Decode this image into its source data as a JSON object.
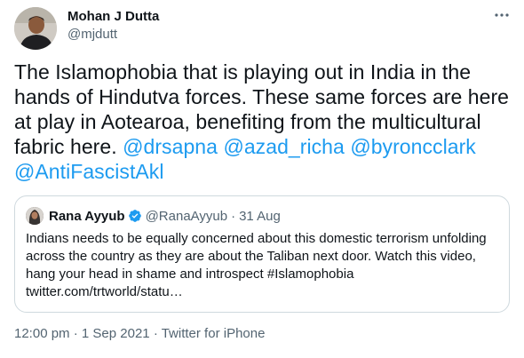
{
  "author": {
    "name": "Mohan J Dutta",
    "handle": "@mjdutt",
    "avatar_icon": "profile-photo"
  },
  "tweet": {
    "text_parts": [
      {
        "text": "The Islamophobia that is playing out in India in the hands of Hindutva forces. These same forces are here at play in Aotearoa, benefiting from the multicultural fabric here. ",
        "type": "text"
      },
      {
        "text": "@drsapna",
        "type": "mention"
      },
      {
        "text": " ",
        "type": "text"
      },
      {
        "text": "@azad_richa",
        "type": "mention"
      },
      {
        "text": " ",
        "type": "text"
      },
      {
        "text": "@byroncclark",
        "type": "mention"
      },
      {
        "text": " ",
        "type": "text"
      },
      {
        "text": "@AntiFascistAkl",
        "type": "mention"
      }
    ]
  },
  "quoted": {
    "name": "Rana Ayyub",
    "verified_icon": "verified-badge-icon",
    "handle": "@RanaAyyub",
    "separator": "·",
    "date": "31 Aug",
    "text": "Indians needs to be equally concerned about this domestic terrorism unfolding across the country as they are about the Taliban next door. Watch this video, hang your head in shame and introspect #Islamophobia twitter.com/trtworld/statu…"
  },
  "meta": {
    "time": "12:00 pm",
    "separator": "·",
    "date": "1 Sep 2021",
    "source": "Twitter for iPhone"
  },
  "colors": {
    "accent": "#1d9bf0",
    "text": "#0f1419",
    "muted": "#536471",
    "border": "#cfd9de"
  }
}
